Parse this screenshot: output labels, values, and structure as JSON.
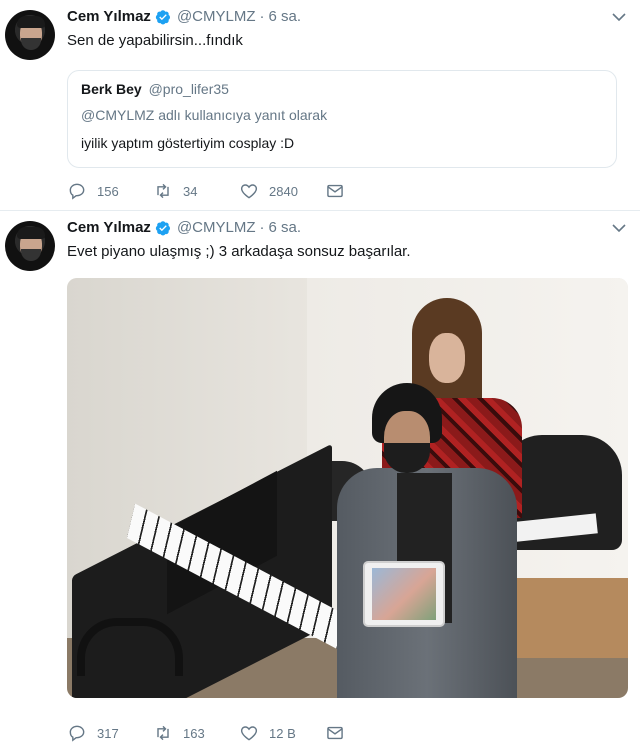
{
  "tweets": [
    {
      "name": "Cem Yılmaz",
      "handle": "@CMYLMZ",
      "dot": "·",
      "time": "6 sa.",
      "text": "Sen de yapabilirsin...fındık",
      "quote": {
        "name": "Berk Bey",
        "handle": "@pro_lifer35",
        "reply_context": "@CMYLMZ adlı kullanıcıya yanıt olarak",
        "text": "iyilik yaptım göstertiyim cosplay :D"
      },
      "actions": {
        "replies": "156",
        "retweets": "34",
        "likes": "2840"
      }
    },
    {
      "name": "Cem Yılmaz",
      "handle": "@CMYLMZ",
      "dot": "·",
      "time": "6 sa.",
      "text": "Evet piyano ulaşmış ;) 3 arkadaşa sonsuz başarılar.",
      "actions": {
        "replies": "317",
        "retweets": "163",
        "likes": "12 B"
      }
    }
  ],
  "colors": {
    "text": "#14171a",
    "secondary": "#657786",
    "verified": "#1da1f2",
    "border": "#e6ecf0"
  },
  "icons": [
    "reply-icon",
    "retweet-icon",
    "like-icon",
    "dm-icon",
    "verified-icon",
    "chevron-down-icon"
  ]
}
